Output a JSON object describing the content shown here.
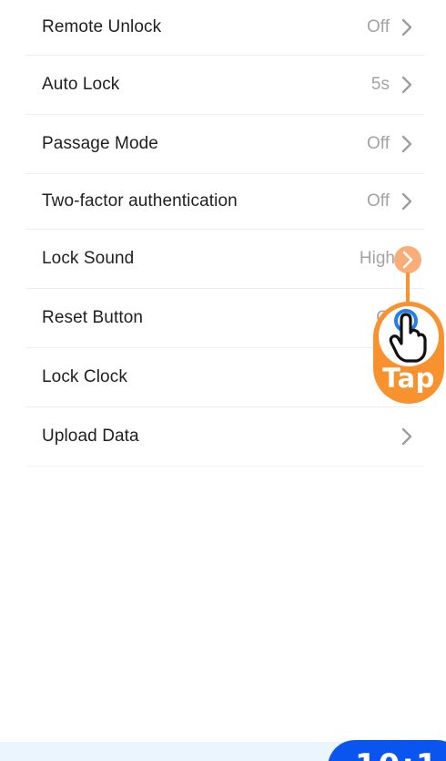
{
  "settings": [
    {
      "label": "Remote Unlock",
      "value": "Off"
    },
    {
      "label": "Auto Lock",
      "value": "5s"
    },
    {
      "label": "Passage Mode",
      "value": "Off"
    },
    {
      "label": "Two-factor authentication",
      "value": "Off"
    },
    {
      "label": "Lock Sound",
      "value": "High"
    },
    {
      "label": "Reset Button",
      "value": "O"
    },
    {
      "label": "Lock Clock",
      "value": ""
    },
    {
      "label": "Upload Data",
      "value": ""
    }
  ],
  "tap_hint": {
    "label": "Tap",
    "icon": "hand-pointer-icon",
    "color": "#f7922f"
  },
  "bottom_badge": {
    "text": "10:1"
  },
  "colors": {
    "label": "#1f1f1f",
    "value": "#a3a3a3",
    "divider": "#eeeeee",
    "accent_blue": "#0a55f0"
  }
}
